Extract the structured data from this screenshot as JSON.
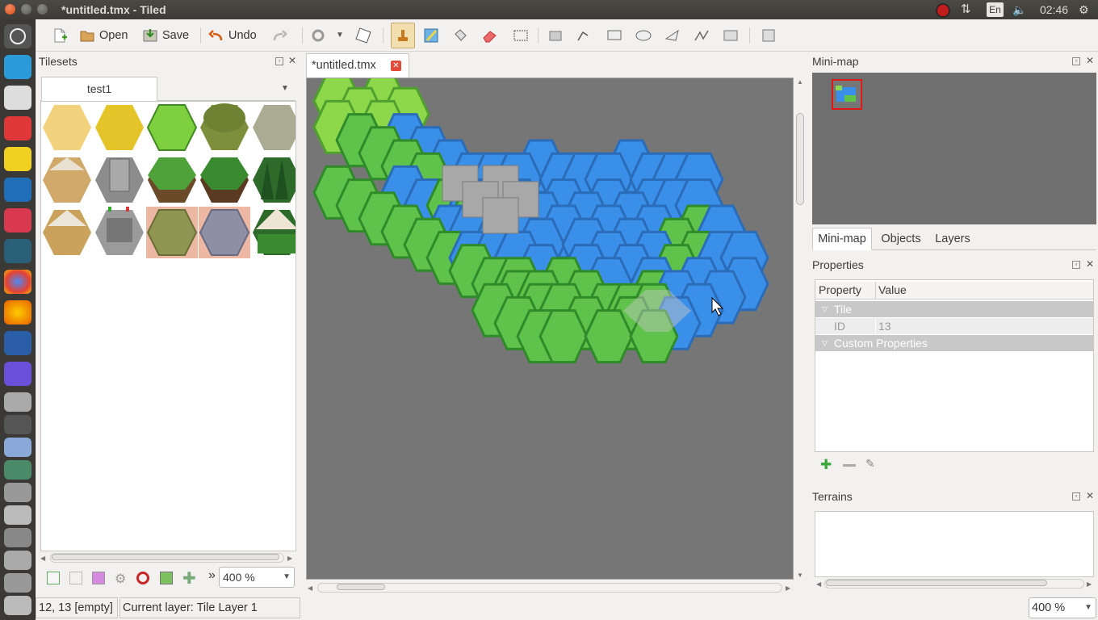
{
  "window": {
    "title": "*untitled.tmx - Tiled"
  },
  "tray": {
    "keyboard": "En",
    "clock": "02:46"
  },
  "toolbar": {
    "open_label": "Open",
    "save_label": "Save",
    "undo_label": "Undo"
  },
  "tilesets": {
    "title": "Tilesets",
    "active_tab": "test1",
    "zoom": "400 %",
    "more": "»"
  },
  "map": {
    "tab_label": "*untitled.tmx"
  },
  "minimap": {
    "title": "Mini-map"
  },
  "right_tabs": [
    "Mini-map",
    "Objects",
    "Layers"
  ],
  "properties": {
    "title": "Properties",
    "col_property": "Property",
    "col_value": "Value",
    "group_tile": "Tile",
    "id_label": "ID",
    "id_value": "13",
    "group_custom": "Custom Properties"
  },
  "terrains": {
    "title": "Terrains"
  },
  "status": {
    "coords": "12, 13 [empty]",
    "layer": "Current layer: Tile Layer 1",
    "zoom": "400 %"
  },
  "colors": {
    "water": "#3a8fe8",
    "grass": "#5fc24a",
    "light_grass": "#8cd84a",
    "map_bg": "#767676"
  }
}
